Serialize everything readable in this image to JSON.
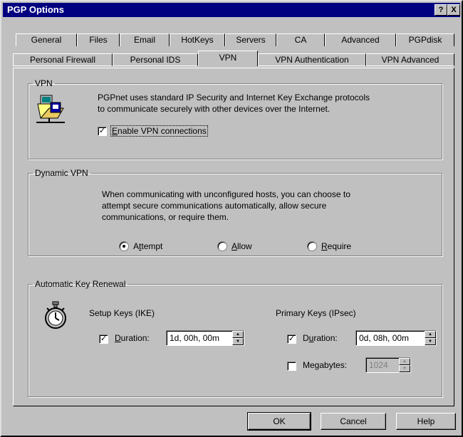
{
  "window": {
    "title": "PGP Options",
    "help_glyph": "?",
    "close_glyph": "X"
  },
  "tabs_row1": [
    "General",
    "Files",
    "Email",
    "HotKeys",
    "Servers",
    "CA",
    "Advanced",
    "PGPdisk"
  ],
  "tabs_row2": [
    "Personal Firewall",
    "Personal IDS",
    "VPN",
    "VPN Authentication",
    "VPN Advanced"
  ],
  "active_tab": "VPN",
  "vpn": {
    "legend": "VPN",
    "description_line1": "PGPnet uses standard IP Security and Internet Key Exchange protocols",
    "description_line2": "to communicate securely with other devices over the Internet.",
    "enable_label_mnemonic": "E",
    "enable_label_rest": "nable VPN connections",
    "enable_checked": true
  },
  "dynamic_vpn": {
    "legend": "Dynamic VPN",
    "line1": "When communicating with unconfigured hosts, you can choose to",
    "line2": "attempt secure communications automatically, allow secure",
    "line3": "communications, or require them.",
    "attempt_pre": "A",
    "attempt_mn": "t",
    "attempt_post": "tempt",
    "allow_pre": "",
    "allow_mn": "A",
    "allow_post": "llow",
    "require_pre": "",
    "require_mn": "R",
    "require_post": "equire",
    "selected": "Attempt"
  },
  "key_renewal": {
    "legend": "Automatic Key Renewal",
    "setup_title": "Setup Keys (IKE)",
    "setup_duration_mn": "D",
    "setup_duration_rest": "uration:",
    "setup_duration_checked": true,
    "setup_duration_value": "1d, 00h, 00m",
    "primary_title": "Primary Keys (IPsec)",
    "primary_duration_pre": "D",
    "primary_duration_mn": "u",
    "primary_duration_post": "ration:",
    "primary_duration_checked": true,
    "primary_duration_value": "0d, 08h, 00m",
    "megabytes_pre": "Me",
    "megabytes_mn": "g",
    "megabytes_post": "abytes:",
    "megabytes_checked": false,
    "megabytes_value": "1024"
  },
  "buttons": {
    "ok": "OK",
    "cancel": "Cancel",
    "help": "Help"
  },
  "glyphs": {
    "check": "✓",
    "up": "▲",
    "down": "▼"
  }
}
